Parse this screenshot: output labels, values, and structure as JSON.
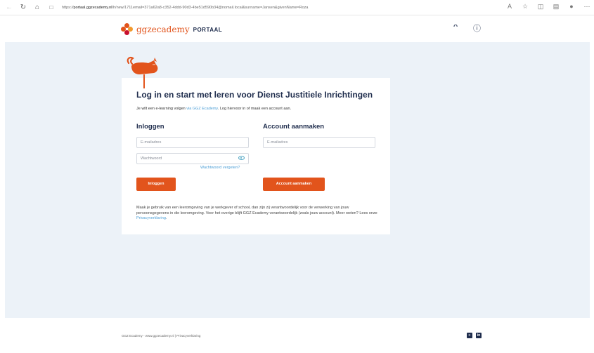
{
  "browser": {
    "url_prefix": "https://",
    "url_domain": "portaal.ggzecademy.nl",
    "url_rest": "/h/new/1711email=371a62a8-c352-4ddd-90d3-4be51d590b34@nomail.local&surname=Jansen&givenName=Roza"
  },
  "header": {
    "logo_text": "ggzecademy",
    "logo_portaal": "PORTAAL"
  },
  "card": {
    "title": "Log in en start met leren voor Dienst Justitiele Inrichtingen",
    "intro_before": "Je wilt een e-learning volgen ",
    "intro_link": "via GGZ Ecademy",
    "intro_after": ". Log hiervoor in of maak een account aan.",
    "login": {
      "title": "Inloggen",
      "email_placeholder": "E-mailadres",
      "password_placeholder": "Wachtwoord",
      "forgot": "Wachtwoord vergeten?",
      "button": "Inloggen"
    },
    "create": {
      "title": "Account aanmaken",
      "email_placeholder": "E-mailadres",
      "button": "Account aanmaken"
    },
    "note_before": "Maak je gebruik van een leeromgeving van je werkgever of school, dan zijn zij verantwoordelijk voor de verwerking van jouw persoonsgegevens in die leeromgeving. Voor het overige blijft GGZ Ecademy verantwoordelijk (zoals jouw account). Meer weten? Lees onze ",
    "note_link": "Privacyverklaring",
    "note_after": "."
  },
  "footer": {
    "text": "GGZ Ecademy - www.ggzecademy.nl | Privacyverklaring",
    "linkedin_label": "in"
  },
  "colors": {
    "accent": "#e2541c",
    "navy": "#1f2d4d",
    "link": "#4d9fd6",
    "band": "#ecf2f8"
  },
  "icons": {
    "back": "arrow-left-icon",
    "reload": "reload-icon",
    "home": "home-icon",
    "lock": "lock-icon",
    "user": "user-icon",
    "help": "help-icon",
    "eye": "eye-icon"
  }
}
